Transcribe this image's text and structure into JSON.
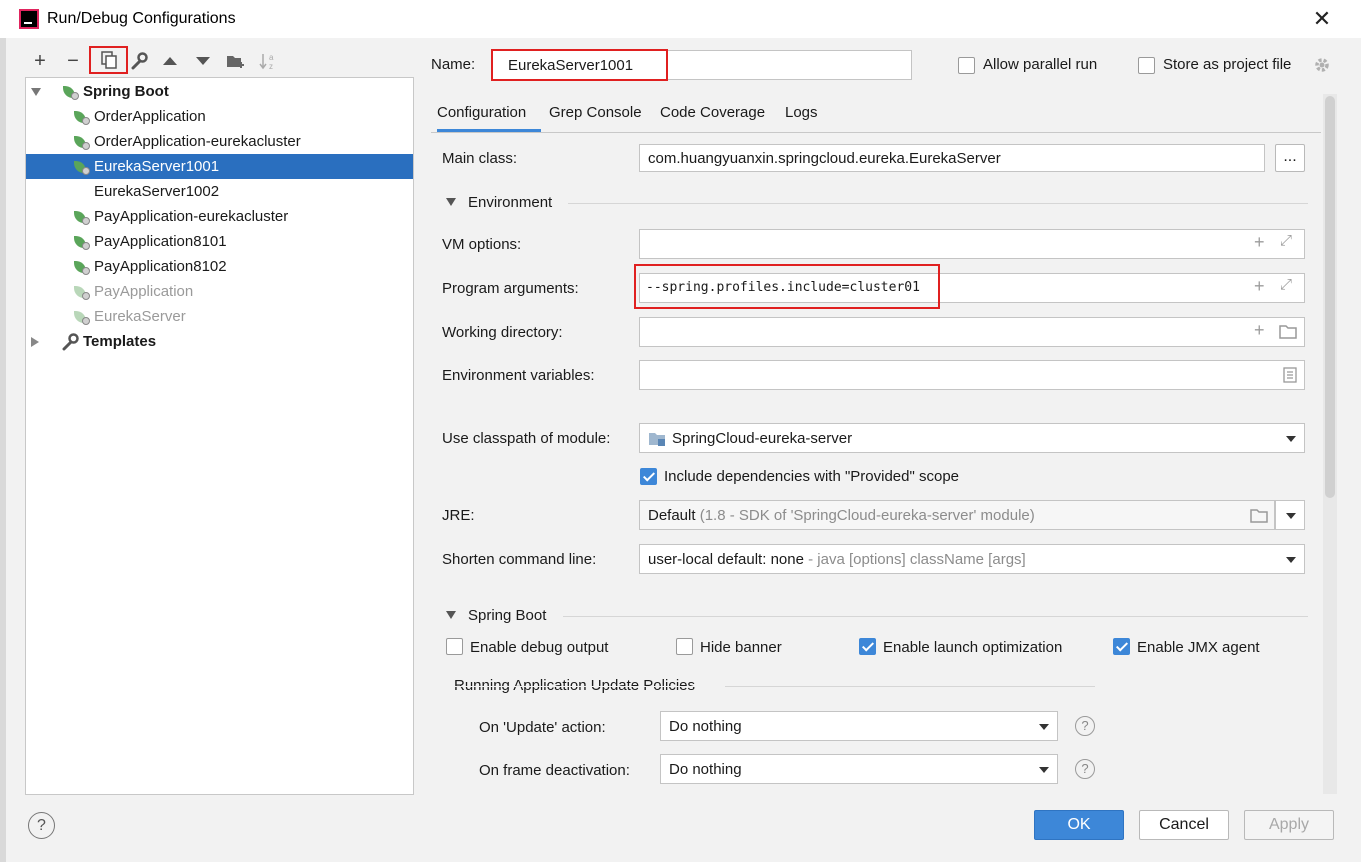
{
  "window": {
    "title": "Run/Debug Configurations",
    "close_glyph": "✕"
  },
  "colors": {
    "selection": "#2a6fbf",
    "accent": "#3d87d8",
    "highlight_box": "#e02020"
  },
  "toolbar": {
    "buttons": [
      {
        "name": "add-icon",
        "glyph": "+"
      },
      {
        "name": "remove-icon",
        "glyph": "−"
      },
      {
        "name": "copy-icon",
        "glyph": "⧉"
      },
      {
        "name": "wrench-icon",
        "glyph": "🔧"
      },
      {
        "name": "move-up-icon",
        "glyph": "▲"
      },
      {
        "name": "move-down-icon",
        "glyph": "▼"
      },
      {
        "name": "folder-add-icon",
        "glyph": "📁"
      },
      {
        "name": "sort-icon",
        "glyph": "↓ᵃ"
      }
    ]
  },
  "tree": {
    "groups": [
      {
        "label": "Spring Boot",
        "expanded": true
      },
      {
        "label": "Templates",
        "expanded": false
      }
    ],
    "items": [
      {
        "label": "OrderApplication",
        "state": "normal"
      },
      {
        "label": "OrderApplication-eurekacluster",
        "state": "normal"
      },
      {
        "label": "EurekaServer1001",
        "state": "selected"
      },
      {
        "label": "EurekaServer1002",
        "state": "noicon"
      },
      {
        "label": "PayApplication-eurekacluster",
        "state": "normal"
      },
      {
        "label": "PayApplication8101",
        "state": "normal"
      },
      {
        "label": "PayApplication8102",
        "state": "normal"
      },
      {
        "label": "PayApplication",
        "state": "disabled"
      },
      {
        "label": "EurekaServer",
        "state": "disabled"
      }
    ]
  },
  "header": {
    "name_label": "Name:",
    "name_value": "EurekaServer1001",
    "allow_parallel_label": "Allow parallel run",
    "allow_parallel_checked": false,
    "store_project_label": "Store as project file",
    "store_project_checked": false
  },
  "tabs": [
    {
      "label": "Configuration",
      "active": true
    },
    {
      "label": "Grep Console",
      "active": false
    },
    {
      "label": "Code Coverage",
      "active": false
    },
    {
      "label": "Logs",
      "active": false
    }
  ],
  "config": {
    "main_class_label": "Main class:",
    "main_class_value": "com.huangyuanxin.springcloud.eureka.EurekaServer",
    "browse_label": "...",
    "environment_header": "Environment",
    "vm_options_label": "VM options:",
    "vm_options_value": "",
    "program_args_label": "Program arguments:",
    "program_args_value": "--spring.profiles.include=cluster01",
    "working_dir_label": "Working directory:",
    "working_dir_value": "",
    "env_vars_label": "Environment variables:",
    "env_vars_value": "",
    "classpath_label": "Use classpath of module:",
    "classpath_value": "SpringCloud-eureka-server",
    "include_deps_label": "Include dependencies with \"Provided\" scope",
    "include_deps_checked": true,
    "jre_label": "JRE:",
    "jre_value": "Default",
    "jre_detail": "(1.8 - SDK of 'SpringCloud-eureka-server' module)",
    "shorten_label": "Shorten command line:",
    "shorten_value": "user-local default: none",
    "shorten_detail": "- java [options] className [args]"
  },
  "spring_boot": {
    "header": "Spring Boot",
    "enable_debug_label": "Enable debug output",
    "enable_debug_checked": false,
    "hide_banner_label": "Hide banner",
    "hide_banner_checked": false,
    "launch_opt_label": "Enable launch optimization",
    "launch_opt_checked": true,
    "jmx_label": "Enable JMX agent",
    "jmx_checked": true,
    "policies_header": "Running Application Update Policies",
    "on_update_label": "On 'Update' action:",
    "on_update_value": "Do nothing",
    "on_frame_label": "On frame deactivation:",
    "on_frame_value": "Do nothing",
    "help_glyph": "?"
  },
  "footer": {
    "help_glyph": "?",
    "ok_label": "OK",
    "cancel_label": "Cancel",
    "apply_label": "Apply"
  }
}
